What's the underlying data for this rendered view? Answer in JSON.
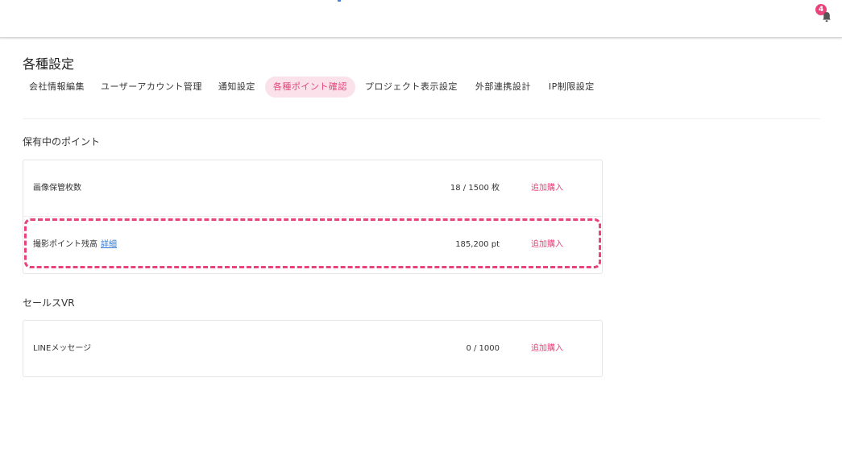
{
  "notifications": {
    "count": "4"
  },
  "page": {
    "title": "各種設定"
  },
  "tabs": [
    {
      "label": "会社情報編集"
    },
    {
      "label": "ユーザーアカウント管理"
    },
    {
      "label": "通知設定"
    },
    {
      "label": "各種ポイント確認",
      "active": true
    },
    {
      "label": "プロジェクト表示設定"
    },
    {
      "label": "外部連携設計"
    },
    {
      "label": "IP制限設定"
    }
  ],
  "points": {
    "title": "保有中のポイント",
    "rows": [
      {
        "label": "画像保管枚数",
        "value": "18 / 1500 枚",
        "action": "追加購入"
      },
      {
        "label": "撮影ポイント残高",
        "link": "詳細",
        "value": "185,200 pt",
        "action": "追加購入"
      }
    ]
  },
  "sales_vr": {
    "title": "セールスVR",
    "rows": [
      {
        "label": "LINEメッセージ",
        "value": "0 / 1000",
        "action": "追加購入"
      }
    ]
  },
  "colors": {
    "accent": "#e8437a",
    "accent_bg": "#fbe1ea",
    "link": "#2f7ad8"
  }
}
